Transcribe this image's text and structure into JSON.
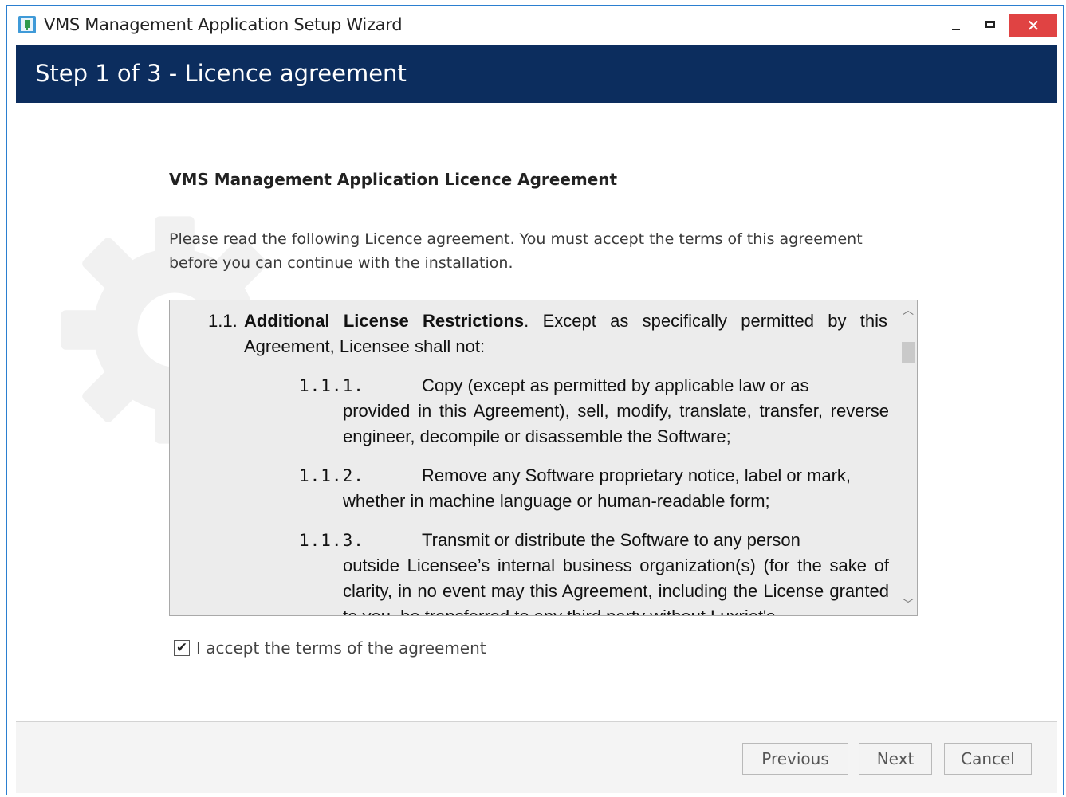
{
  "window": {
    "title": "VMS Management Application Setup Wizard",
    "icon": "setup-app-icon",
    "controls": {
      "minimize": "minimize-icon",
      "maximize": "maximize-icon",
      "close_label": "✕"
    }
  },
  "header": {
    "step_title": "Step 1 of 3 - Licence agreement"
  },
  "main": {
    "agreement_title": "VMS Management Application Licence Agreement",
    "instruction": "Please read the following Licence agreement. You must accept the terms of this agreement before you can continue with the installation.",
    "license": {
      "clause": {
        "number": "1.1.",
        "heading": "Additional License Restrictions",
        "text": ". Except as specifically permitted by this Agreement, Licensee shall not:"
      },
      "subclauses": [
        {
          "number": "1.1.1.",
          "first_line": "Copy (except as permitted by applicable law or as",
          "rest": "provided in this Agreement), sell, modify, translate, transfer, reverse engineer, decompile or disassemble the Software;"
        },
        {
          "number": "1.1.2.",
          "first_line": "Remove any Software proprietary notice, label or mark,",
          "rest": "whether in machine language or human-readable form;"
        },
        {
          "number": "1.1.3.",
          "first_line": "Transmit or distribute the Software to any person",
          "rest": "outside Licensee’s internal business organization(s) (for the sake of clarity, in no event may this Agreement, including the License granted to you, be transferred to any third party without Luxriot's"
        }
      ]
    },
    "accept_checkbox": {
      "label": "I accept the terms of the agreement",
      "checked": true,
      "check_glyph": "✔"
    }
  },
  "footer": {
    "previous_label": "Previous",
    "next_label": "Next",
    "cancel_label": "Cancel"
  },
  "colors": {
    "header_bg": "#0c2d5e",
    "close_button": "#e04343",
    "window_border": "#2b7fd0",
    "license_bg": "#ececec"
  }
}
